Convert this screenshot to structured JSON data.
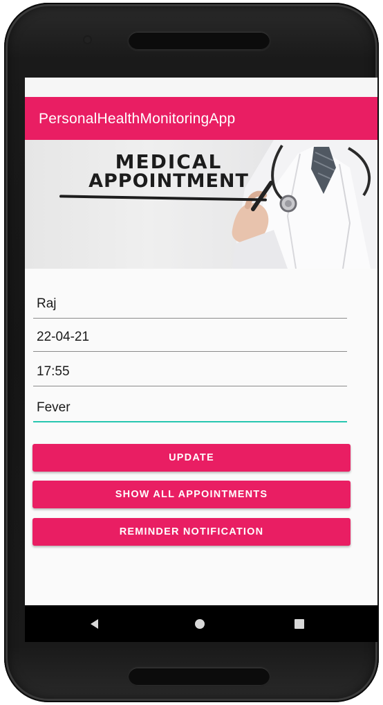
{
  "app_bar": {
    "title": "PersonalHealthMonitoringApp"
  },
  "banner": {
    "line1": "MEDICAL",
    "line2": "APPOINTMENT"
  },
  "form": {
    "name": "Raj",
    "date": "22-04-21",
    "time": "17:55",
    "reason": "Fever"
  },
  "buttons": {
    "update": "UPDATE",
    "show_all": "SHOW ALL APPOINTMENTS",
    "reminder": "REMINDER NOTIFICATION"
  },
  "navigation": {
    "back_icon": "back-triangle-icon",
    "home_icon": "home-circle-icon",
    "recents_icon": "recents-square-icon"
  },
  "colors": {
    "primary": "#e91e63",
    "accent": "#26c6b0",
    "nav_bar": "#000000"
  }
}
